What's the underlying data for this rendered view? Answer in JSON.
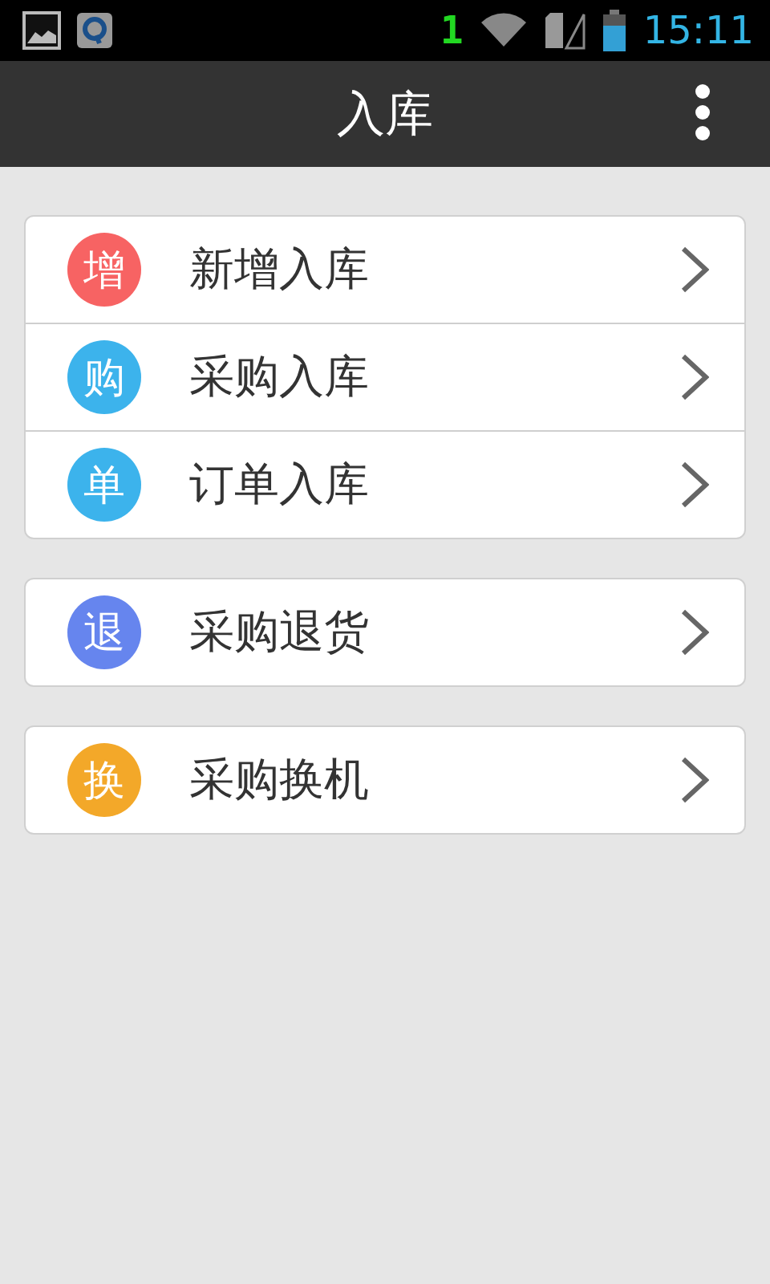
{
  "status_bar": {
    "sim_number": "1",
    "time": "15:11"
  },
  "action_bar": {
    "title": "入库"
  },
  "groups": [
    {
      "items": [
        {
          "badge": "增",
          "label": "新增入库",
          "color": "#f76363"
        },
        {
          "badge": "购",
          "label": "采购入库",
          "color": "#3cb3ec"
        },
        {
          "badge": "单",
          "label": "订单入库",
          "color": "#3cb3ec"
        }
      ]
    },
    {
      "items": [
        {
          "badge": "退",
          "label": "采购退货",
          "color": "#6685ee"
        }
      ]
    },
    {
      "items": [
        {
          "badge": "换",
          "label": "采购换机",
          "color": "#f3a829"
        }
      ]
    }
  ]
}
